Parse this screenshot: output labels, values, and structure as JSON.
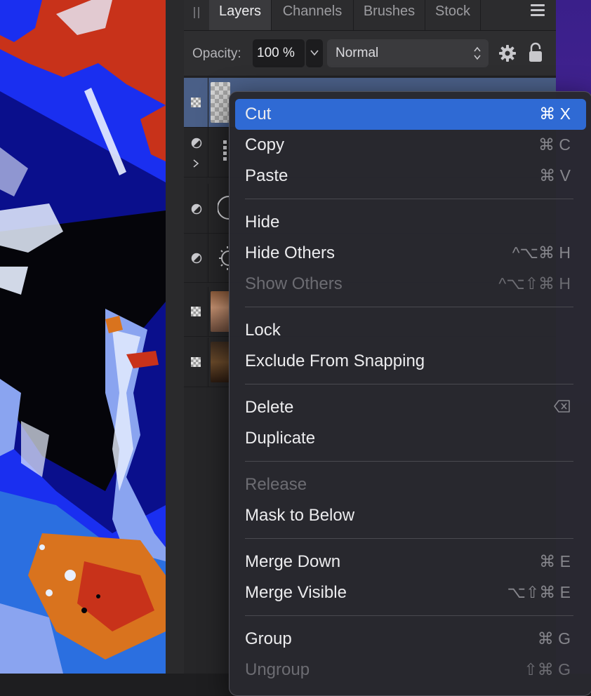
{
  "layers_panel": {
    "tabs": [
      {
        "label": "Layers",
        "active": true
      },
      {
        "label": "Channels",
        "active": false
      },
      {
        "label": "Brushes",
        "active": false
      },
      {
        "label": "Stock",
        "active": false
      }
    ],
    "opacity_label": "Opacity:",
    "opacity_value": "100 %",
    "blend_mode": "Normal",
    "icons": [
      "grip-icon",
      "hamburger-menu-icon",
      "chevron-down-icon",
      "up-down-chevron-icon",
      "gear-icon",
      "lock-icon"
    ]
  },
  "layer_rows": [
    {
      "kind": "pixel",
      "selected": true,
      "icon": "checkerboard-icon"
    },
    {
      "kind": "group",
      "selected": false,
      "icon": "half-circle-icon",
      "expand_icon": "chevron-right-icon"
    },
    {
      "kind": "adjustment",
      "selected": false,
      "icon": "half-circle-icon"
    },
    {
      "kind": "adjustment",
      "selected": false,
      "icon": "half-circle-icon"
    },
    {
      "kind": "pixel",
      "selected": false,
      "icon": "checkerboard-icon"
    },
    {
      "kind": "pixel",
      "selected": false,
      "icon": "checkerboard-icon"
    }
  ],
  "context_menu": {
    "groups": [
      [
        {
          "label": "Cut",
          "shortcut": "⌘ X",
          "highlighted": true,
          "disabled": false
        },
        {
          "label": "Copy",
          "shortcut": "⌘ C",
          "highlighted": false,
          "disabled": false
        },
        {
          "label": "Paste",
          "shortcut": "⌘ V",
          "highlighted": false,
          "disabled": false
        }
      ],
      [
        {
          "label": "Hide",
          "shortcut": "",
          "highlighted": false,
          "disabled": false
        },
        {
          "label": "Hide Others",
          "shortcut": "^⌥⌘ H",
          "highlighted": false,
          "disabled": false
        },
        {
          "label": "Show Others",
          "shortcut": "^⌥⇧⌘ H",
          "highlighted": false,
          "disabled": true
        }
      ],
      [
        {
          "label": "Lock",
          "shortcut": "",
          "highlighted": false,
          "disabled": false
        },
        {
          "label": "Exclude From Snapping",
          "shortcut": "",
          "highlighted": false,
          "disabled": false
        }
      ],
      [
        {
          "label": "Delete",
          "shortcut": "",
          "shortcut_icon": "delete-key-icon",
          "highlighted": false,
          "disabled": false
        },
        {
          "label": "Duplicate",
          "shortcut": "",
          "highlighted": false,
          "disabled": false
        }
      ],
      [
        {
          "label": "Release",
          "shortcut": "",
          "highlighted": false,
          "disabled": true
        },
        {
          "label": "Mask to Below",
          "shortcut": "",
          "highlighted": false,
          "disabled": false
        }
      ],
      [
        {
          "label": "Merge Down",
          "shortcut": "⌘ E",
          "highlighted": false,
          "disabled": false
        },
        {
          "label": "Merge Visible",
          "shortcut": "⌥⇧⌘ E",
          "highlighted": false,
          "disabled": false
        }
      ],
      [
        {
          "label": "Group",
          "shortcut": "⌘ G",
          "highlighted": false,
          "disabled": false
        },
        {
          "label": "Ungroup",
          "shortcut": "⇧⌘ G",
          "highlighted": false,
          "disabled": true
        }
      ]
    ],
    "colors": {
      "highlight": "#2f6ad4",
      "text": "#ececee",
      "disabled_text": "#6c6c72",
      "shortcut_text": "#86868c"
    }
  },
  "canvas": {
    "colors": {
      "blue": "#1a2ff0",
      "dark_blue": "#0a0f8c",
      "red": "#c8321a",
      "orange": "#d9731e",
      "white": "#e8f0ff",
      "black": "#05050a"
    }
  }
}
